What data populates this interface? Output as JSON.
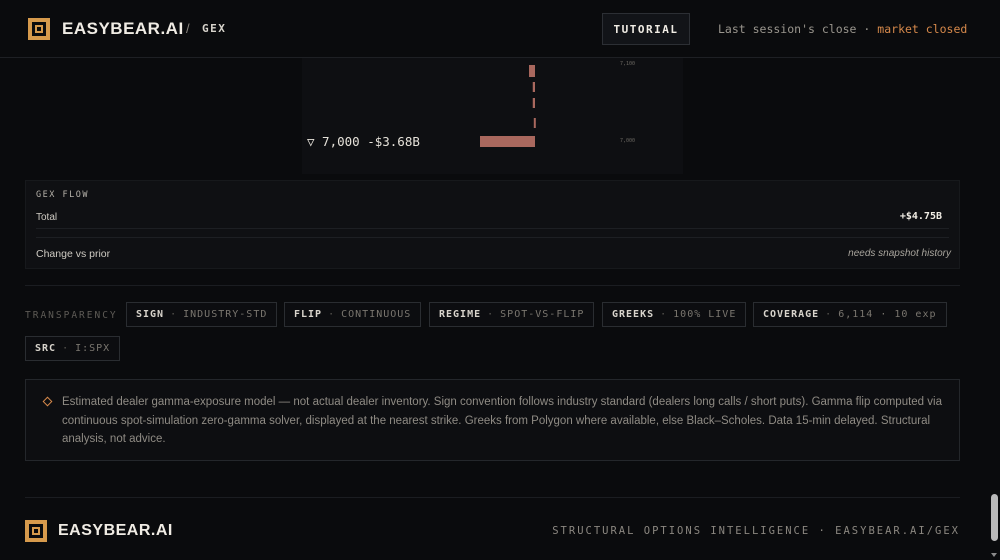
{
  "header": {
    "brand": "EASYBEAR.AI",
    "separator": "/",
    "page": "GEX",
    "tutorial_label": "TUTORIAL",
    "session_text": "Last session's close",
    "session_sep": "·",
    "market_status": "market closed"
  },
  "chart_data": {
    "type": "bar",
    "orientation": "horizontal",
    "categories": [
      "7,100",
      "",
      "",
      "",
      "7,000"
    ],
    "values": [
      -0.4,
      -0.15,
      -0.15,
      -0.08,
      -3.68
    ],
    "tick_labels": [
      "7,100",
      "7,000"
    ],
    "annotation": {
      "marker": "▽",
      "strike": "7,000",
      "value": "-$3.68B"
    },
    "bar_color": "#a9685e"
  },
  "gex_flow": {
    "title": "GEX FLOW",
    "total_label": "Total",
    "total_value": "+$4.75B",
    "change_label": "Change vs prior",
    "change_value": "needs snapshot history"
  },
  "transparency": {
    "label": "TRANSPARENCY",
    "chips": [
      {
        "key": "SIGN",
        "value": "INDUSTRY-STD"
      },
      {
        "key": "FLIP",
        "value": "CONTINUOUS"
      },
      {
        "key": "REGIME",
        "value": "SPOT-VS-FLIP"
      },
      {
        "key": "GREEKS",
        "value": "100% LIVE"
      },
      {
        "key": "COVERAGE",
        "value": "6,114 · 10 exp"
      },
      {
        "key": "SRC",
        "value": "I:SPX"
      }
    ]
  },
  "notice": {
    "text": "Estimated dealer gamma-exposure model — not actual dealer inventory. Sign convention follows industry standard (dealers long calls / short puts). Gamma flip computed via continuous spot-simulation zero-gamma solver, displayed at the nearest strike. Greeks from Polygon where available, else Black–Scholes. Data 15-min delayed. Structural analysis, not advice."
  },
  "footer": {
    "brand": "EASYBEAR.AI",
    "tagline": "STRUCTURAL OPTIONS INTELLIGENCE · EASYBEAR.AI/GEX"
  }
}
